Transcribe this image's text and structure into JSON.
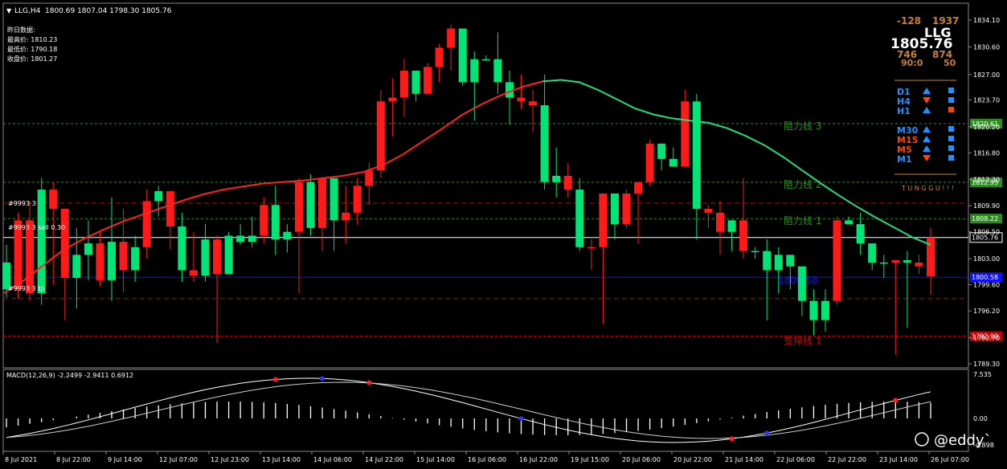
{
  "header": {
    "symbol_tf": "LLG,H4",
    "ohlc": "1800.69 1807.04 1798.30 1805.76"
  },
  "info_box": {
    "title": "昨日数据:",
    "lines": [
      "最高价: 1810.23",
      "最低价: 1790.18",
      "收盘价: 1801.27"
    ]
  },
  "top_right": {
    "neg": "-128",
    "pos": "1937",
    "symbol": "LLG",
    "price": "1805.76",
    "v1": "746",
    "v2": "874",
    "v3": "90:0",
    "v4": "50"
  },
  "tf_panel": [
    {
      "tf": "D1",
      "arrow": "up",
      "sq": "blue",
      "color": "#1e90ff"
    },
    {
      "tf": "H4",
      "arrow": "down",
      "sq": "blue",
      "color": "#1e90ff"
    },
    {
      "tf": "H1",
      "arrow": "up",
      "sq": "red",
      "color": "#1e90ff"
    },
    {
      "tf": "M30",
      "arrow": "up",
      "sq": "blue",
      "color": "#1e90ff"
    },
    {
      "tf": "M15",
      "arrow": "up",
      "sq": "blue",
      "color": "#ff4500"
    },
    {
      "tf": "M5",
      "arrow": "up",
      "sq": "blue",
      "color": "#ff4500"
    },
    {
      "tf": "M1",
      "arrow": "down",
      "sq": "blue",
      "color": "#1e90ff"
    }
  ],
  "tunggu": "T U N G G U ! ! !",
  "price_axis": {
    "ticks": [
      "1834.10",
      "1830.60",
      "1827.00",
      "1823.70",
      "1820.20",
      "1816.80",
      "1813.30",
      "1809.90",
      "1806.50",
      "1803.00",
      "1799.60",
      "1796.20",
      "1792.70",
      "1789.30"
    ],
    "tick_values": [
      1834.1,
      1830.6,
      1827.0,
      1823.7,
      1820.2,
      1816.8,
      1813.3,
      1809.9,
      1806.5,
      1803.0,
      1799.6,
      1796.2,
      1792.7,
      1789.3
    ]
  },
  "levels": [
    {
      "name": "阻力线 3",
      "price": 1820.61,
      "tag": "1820.61",
      "color": "#2e8b22",
      "label": "阻力线 3"
    },
    {
      "name": "阻力线 2",
      "price": 1812.95,
      "tag": "1812.95",
      "color": "#2e8b22",
      "label": "阻力线 2"
    },
    {
      "name": "阻力线 1",
      "price": 1808.22,
      "tag": "1808.22",
      "color": "#2e8b22",
      "label": "阻力线 1"
    },
    {
      "name": "current",
      "price": 1805.76,
      "tag": "1805.76",
      "color": "#ffffff",
      "label": ""
    },
    {
      "name": "pivot",
      "price": 1800.58,
      "tag": "1800.58",
      "color": "#1010ff",
      "label": "1800.58"
    },
    {
      "name": "支撑线 1",
      "price": 1792.9,
      "tag": "1792.90",
      "color": "#cc0000",
      "label": "支撑线 1"
    }
  ],
  "left_labels": [
    "#9993 3",
    "#9993 3 sell 0.30",
    "#9993 3 tp"
  ],
  "time_axis": [
    "8 Jul 2021",
    "8 Jul 22:00",
    "9 Jul 14:00",
    "12 Jul 07:00",
    "12 Jul 23:00",
    "13 Jul 14:00",
    "14 Jul 06:00",
    "14 Jul 22:00",
    "15 Jul 14:00",
    "16 Jul 06:00",
    "16 Jul 22:00",
    "19 Jul 15:00",
    "20 Jul 06:00",
    "20 Jul 22:00",
    "21 Jul 14:00",
    "22 Jul 06:00",
    "22 Jul 22:00",
    "23 Jul 14:00",
    "26 Jul 07:00"
  ],
  "macd": {
    "label": "MACD(12,26,9) -2.2499 -2.9411 0.6912",
    "ticks": [
      "7.535",
      "0.00",
      "-4.898"
    ],
    "tick_values": [
      7.535,
      0.0,
      -4.898
    ]
  },
  "watermark": "@eddy`",
  "chart_data": {
    "type": "candlestick",
    "title": "LLG,H4",
    "ylim": [
      1788.7,
      1835.5
    ],
    "candles": [
      [
        1802.5,
        1804.8,
        1798.0,
        1799.0
      ],
      [
        1799.0,
        1809.0,
        1797.8,
        1808.0
      ],
      [
        1808.0,
        1810.5,
        1797.5,
        1798.5
      ],
      [
        1798.5,
        1813.5,
        1797.0,
        1812.0
      ],
      [
        1812.0,
        1813.0,
        1799.6,
        1809.5
      ],
      [
        1809.5,
        1808.5,
        1795.0,
        1800.5
      ],
      [
        1800.5,
        1807.0,
        1796.5,
        1803.5
      ],
      [
        1803.5,
        1808.0,
        1800.2,
        1805.0
      ],
      [
        1805.0,
        1806.5,
        1799.4,
        1800.2
      ],
      [
        1800.2,
        1811.0,
        1797.5,
        1805.2
      ],
      [
        1805.2,
        1809.5,
        1798.6,
        1801.5
      ],
      [
        1801.5,
        1806.0,
        1800.0,
        1804.5
      ],
      [
        1804.5,
        1812.0,
        1803.0,
        1810.5
      ],
      [
        1810.5,
        1812.5,
        1808.5,
        1811.8
      ],
      [
        1811.8,
        1810.5,
        1804.2,
        1807.2
      ],
      [
        1807.2,
        1809.0,
        1800.0,
        1801.5
      ],
      [
        1801.5,
        1806.5,
        1800.0,
        1800.8
      ],
      [
        1800.8,
        1807.5,
        1800.0,
        1805.5
      ],
      [
        1805.5,
        1806.0,
        1792.0,
        1801.0
      ],
      [
        1801.0,
        1806.5,
        1801.0,
        1806.0
      ],
      [
        1806.0,
        1807.5,
        1804.8,
        1805.2
      ],
      [
        1805.2,
        1808.5,
        1804.5,
        1806.0
      ],
      [
        1806.0,
        1811.0,
        1805.0,
        1810.0
      ],
      [
        1810.0,
        1812.5,
        1803.5,
        1805.5
      ],
      [
        1805.5,
        1807.5,
        1803.8,
        1806.5
      ],
      [
        1806.5,
        1813.5,
        1798.5,
        1813.0
      ],
      [
        1813.0,
        1814.0,
        1806.0,
        1807.0
      ],
      [
        1807.0,
        1813.5,
        1804.0,
        1813.5
      ],
      [
        1813.5,
        1812.0,
        1804.0,
        1808.0
      ],
      [
        1808.0,
        1812.5,
        1805.0,
        1809.0
      ],
      [
        1809.0,
        1813.5,
        1807.5,
        1812.5
      ],
      [
        1812.5,
        1815.5,
        1810.0,
        1814.5
      ],
      [
        1814.5,
        1825.0,
        1813.5,
        1823.5
      ],
      [
        1823.5,
        1826.5,
        1819.0,
        1824.0
      ],
      [
        1824.0,
        1829.0,
        1821.5,
        1827.5
      ],
      [
        1827.5,
        1827.0,
        1823.5,
        1824.5
      ],
      [
        1824.5,
        1828.5,
        1825.5,
        1828.0
      ],
      [
        1828.0,
        1831.0,
        1826.0,
        1830.5
      ],
      [
        1830.5,
        1833.5,
        1827.5,
        1833.0
      ],
      [
        1833.0,
        1832.5,
        1825.5,
        1826.0
      ],
      [
        1826.0,
        1830.0,
        1821.0,
        1829.0
      ],
      [
        1829.0,
        1829.5,
        1829.0,
        1829.0
      ],
      [
        1829.0,
        1832.5,
        1824.5,
        1826.0
      ],
      [
        1826.0,
        1827.5,
        1820.5,
        1824.0
      ],
      [
        1824.0,
        1827.0,
        1822.5,
        1823.5
      ],
      [
        1823.5,
        1825.0,
        1819.5,
        1823.0
      ],
      [
        1823.0,
        1827.0,
        1812.0,
        1813.0
      ],
      [
        1813.0,
        1817.5,
        1811.0,
        1813.8
      ],
      [
        1813.8,
        1815.5,
        1811.0,
        1812.0
      ],
      [
        1812.0,
        1813.5,
        1804.0,
        1804.5
      ],
      [
        1804.5,
        1805.5,
        1801.5,
        1804.5
      ],
      [
        1804.5,
        1811.5,
        1794.5,
        1811.5
      ],
      [
        1811.5,
        1811.5,
        1805.5,
        1807.5
      ],
      [
        1807.5,
        1812.0,
        1807.0,
        1811.5
      ],
      [
        1811.5,
        1812.5,
        1805.0,
        1813.0
      ],
      [
        1813.0,
        1818.5,
        1812.5,
        1818.0
      ],
      [
        1818.0,
        1818.0,
        1814.5,
        1816.0
      ],
      [
        1816.0,
        1817.5,
        1815.0,
        1815.0
      ],
      [
        1815.0,
        1825.0,
        1817.0,
        1823.5
      ],
      [
        1823.5,
        1824.5,
        1805.5,
        1809.5
      ],
      [
        1809.5,
        1810.0,
        1807.0,
        1809.0
      ],
      [
        1809.0,
        1810.5,
        1803.5,
        1806.5
      ],
      [
        1806.5,
        1808.0,
        1804.0,
        1808.0
      ],
      [
        1808.0,
        1813.5,
        1803.0,
        1804.0
      ],
      [
        1804.0,
        1804.5,
        1803.0,
        1804.0
      ],
      [
        1804.0,
        1805.5,
        1795.0,
        1801.5
      ],
      [
        1801.5,
        1804.5,
        1798.5,
        1803.5
      ],
      [
        1803.5,
        1803.0,
        1799.0,
        1802.0
      ],
      [
        1802.0,
        1801.5,
        1795.5,
        1797.5
      ],
      [
        1797.5,
        1799.0,
        1793.0,
        1795.0
      ],
      [
        1795.0,
        1799.0,
        1793.5,
        1797.5
      ],
      [
        1797.5,
        1808.5,
        1797.0,
        1808.0
      ],
      [
        1808.0,
        1808.5,
        1807.5,
        1807.5
      ],
      [
        1807.5,
        1809.0,
        1803.5,
        1805.0
      ],
      [
        1805.0,
        1803.5,
        1801.5,
        1802.5
      ],
      [
        1802.5,
        1803.5,
        1800.5,
        1802.5
      ],
      [
        1802.5,
        1802.5,
        1790.5,
        1802.8
      ],
      [
        1802.8,
        1804.0,
        1794.0,
        1802.5
      ],
      [
        1802.5,
        1803.5,
        1801.0,
        1802.0
      ],
      [
        1800.69,
        1807.04,
        1798.3,
        1805.76
      ]
    ],
    "candle_colors": [
      "g",
      "r",
      "r",
      "g",
      "r",
      "r",
      "g",
      "g",
      "r",
      "g",
      "r",
      "g",
      "r",
      "g",
      "r",
      "g",
      "r",
      "g",
      "r",
      "g",
      "g",
      "g",
      "r",
      "g",
      "g",
      "r",
      "g",
      "r",
      "g",
      "r",
      "r",
      "r",
      "r",
      "r",
      "r",
      "g",
      "r",
      "r",
      "r",
      "g",
      "g",
      "g",
      "g",
      "g",
      "r",
      "r",
      "g",
      "g",
      "r",
      "g",
      "r",
      "r",
      "g",
      "r",
      "r",
      "r",
      "g",
      "g",
      "r",
      "g",
      "r",
      "r",
      "g",
      "r",
      "g",
      "g",
      "g",
      "g",
      "g",
      "g",
      "g",
      "r",
      "g",
      "g",
      "g",
      "g",
      "r",
      "g",
      "r",
      "r"
    ],
    "ma_red": [
      1798.5,
      1800.2,
      1802.2,
      1804.2,
      1805.6,
      1806.8,
      1807.9,
      1808.8,
      1809.7,
      1810.6,
      1811.4,
      1812.0,
      1812.4,
      1812.8,
      1813.0,
      1813.2,
      1813.5,
      1813.8,
      1814.3,
      1815.2,
      1816.6,
      1818.3,
      1820.0,
      1821.8,
      1823.2,
      1824.4,
      1825.4,
      1826.1
    ],
    "ma_green": [
      1826.1,
      1826.3,
      1826.0,
      1825.0,
      1823.8,
      1822.6,
      1821.8,
      1821.3,
      1821.0,
      1820.7,
      1820.0,
      1819.0,
      1817.8,
      1816.3,
      1814.6,
      1812.9,
      1811.3,
      1809.8,
      1808.4,
      1807.1,
      1805.8,
      1804.8
    ]
  }
}
